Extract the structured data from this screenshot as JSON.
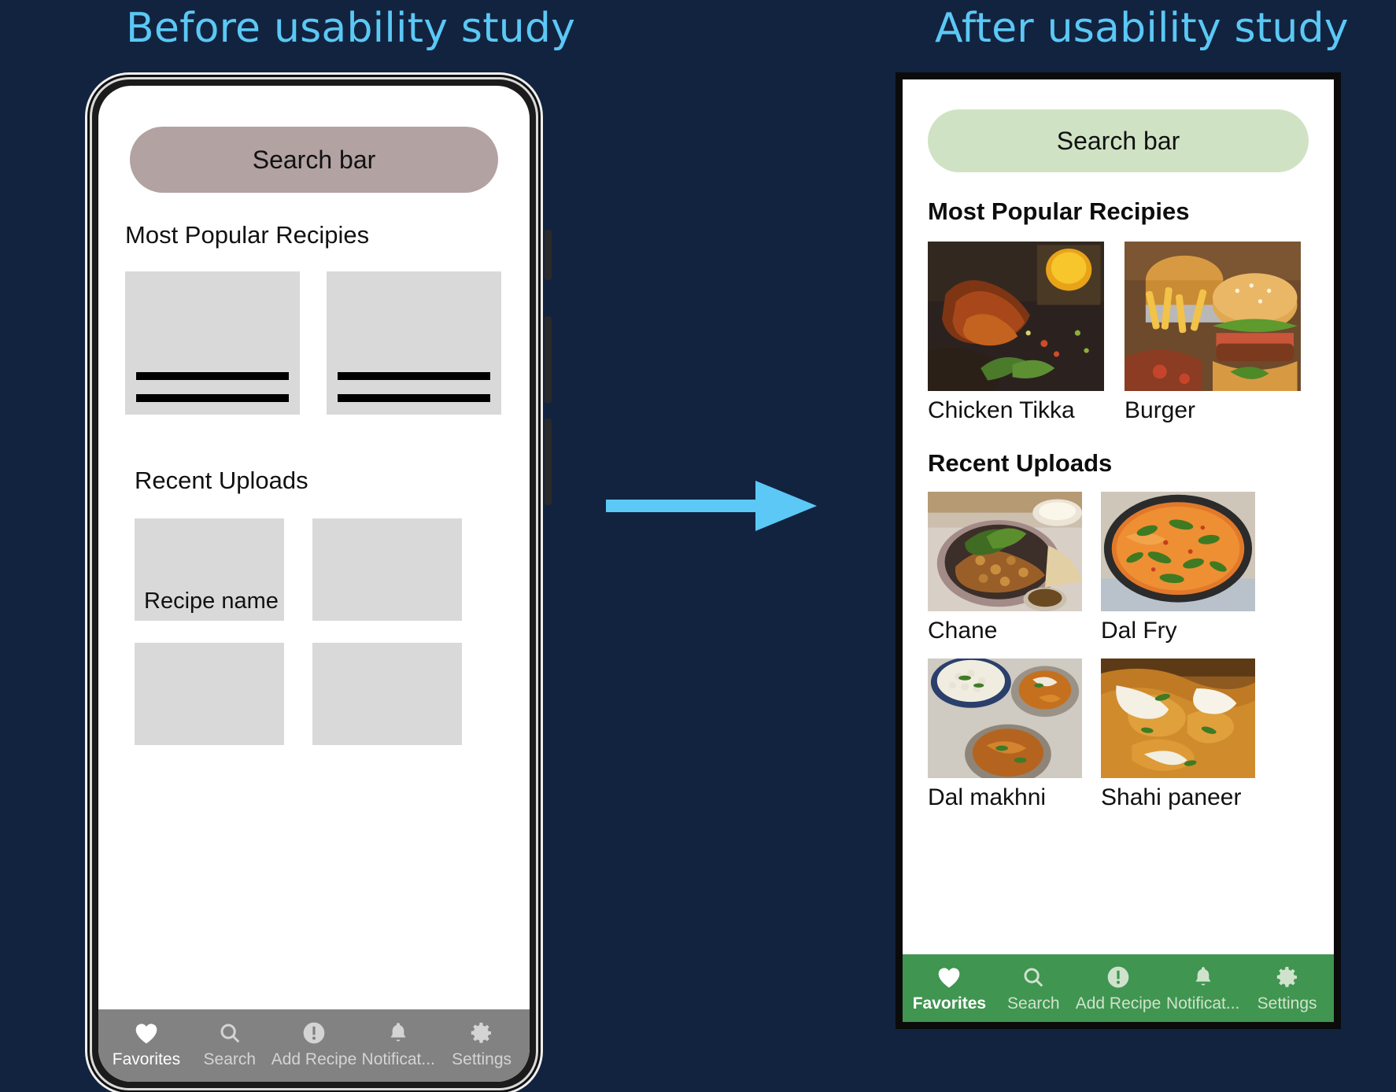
{
  "page": {
    "background_color": "#122340",
    "accent_color": "#5BC8F5"
  },
  "headings": {
    "before": "Before usability study",
    "after": "After usability study"
  },
  "arrow": {
    "name": "right-arrow",
    "color": "#5BC8F5",
    "direction": "right"
  },
  "before_phone": {
    "frame_style": "device-mockup",
    "search_bar": {
      "label": "Search bar",
      "color": "#b3a2a2"
    },
    "sections": [
      {
        "heading": "Most Popular Recipies",
        "cards": [
          {
            "label": ""
          },
          {
            "label": ""
          }
        ]
      },
      {
        "heading": "Recent Uploads",
        "tiles": [
          {
            "label": "Recipe name"
          },
          {
            "label": ""
          },
          {
            "label": ""
          },
          {
            "label": ""
          }
        ]
      }
    ],
    "navbar": {
      "color": "#828282",
      "items": [
        {
          "label": "Favorites",
          "icon": "heart-icon",
          "active": true
        },
        {
          "label": "Search",
          "icon": "search-icon",
          "active": false
        },
        {
          "label": "Add Recipe",
          "icon": "exclamation-circle-icon",
          "active": false
        },
        {
          "label": "Notificat...",
          "icon": "bell-icon",
          "active": false
        },
        {
          "label": "Settings",
          "icon": "gear-icon",
          "active": false
        }
      ]
    }
  },
  "after_phone": {
    "frame_style": "flat-black-border",
    "search_bar": {
      "label": "Search bar",
      "color": "#cfe3c4"
    },
    "sections": [
      {
        "heading": "Most Popular Recipies",
        "cards": [
          {
            "name": "Chicken Tikka",
            "image": "grilled-chicken-photo"
          },
          {
            "name": "Burger",
            "image": "burger-and-fries-photo"
          }
        ]
      },
      {
        "heading": "Recent Uploads",
        "cards": [
          {
            "name": "Chane",
            "image": "chickpea-curry-photo"
          },
          {
            "name": "Dal Fry",
            "image": "dal-fry-pan-photo"
          },
          {
            "name": "Dal makhni",
            "image": "dal-makhni-thali-photo"
          },
          {
            "name": "Shahi paneer",
            "image": "shahi-paneer-photo"
          }
        ]
      }
    ],
    "navbar": {
      "color": "#409550",
      "items": [
        {
          "label": "Favorites",
          "icon": "heart-icon",
          "active": true
        },
        {
          "label": "Search",
          "icon": "search-icon",
          "active": false
        },
        {
          "label": "Add Recipe",
          "icon": "exclamation-circle-icon",
          "active": false
        },
        {
          "label": "Notificat...",
          "icon": "bell-icon",
          "active": false
        },
        {
          "label": "Settings",
          "icon": "gear-icon",
          "active": false
        }
      ]
    }
  }
}
